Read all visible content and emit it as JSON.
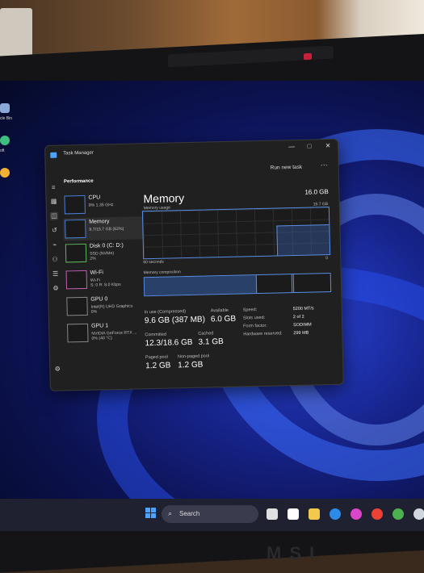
{
  "desktop": {
    "icons": [
      {
        "label": "cle Bin"
      },
      {
        "label": "oft"
      }
    ]
  },
  "task_manager": {
    "window_title": "Task Manager",
    "section_title": "Performance",
    "run_new_task": "Run new task",
    "more": "···",
    "window_buttons": {
      "minimize": "—",
      "maximize": "□",
      "close": "✕"
    },
    "sidebar": [
      {
        "name": "CPU",
        "sub": "9%  1.35 GHz",
        "sub2": ""
      },
      {
        "name": "Memory",
        "sub": "9.7/15.7 GB (62%)",
        "sub2": ""
      },
      {
        "name": "Disk 0 (C: D:)",
        "sub": "SSD (NVMe)",
        "sub2": "2%"
      },
      {
        "name": "Wi-Fi",
        "sub": "Wi-Fi",
        "sub2": "S: 0  R: 8.0 Kbps"
      },
      {
        "name": "GPU 0",
        "sub": "Intel(R) UHD Graphics",
        "sub2": "0%"
      },
      {
        "name": "GPU 1",
        "sub": "NVIDIA GeForce RTX ...",
        "sub2": "0% (40 °C)"
      }
    ],
    "memory": {
      "title": "Memory",
      "total": "16.0 GB",
      "usage_label": "Memory usage",
      "usage_max": "15.7 GB",
      "axis_left": "60 seconds",
      "axis_right": "0",
      "composition_label": "Memory composition",
      "in_use_label": "In use (Compressed)",
      "in_use_value": "9.6 GB (387 MB)",
      "available_label": "Available",
      "available_value": "6.0 GB",
      "committed_label": "Committed",
      "committed_value": "12.3/18.6 GB",
      "cached_label": "Cached",
      "cached_value": "3.1 GB",
      "paged_label": "Paged pool",
      "paged_value": "1.2 GB",
      "nonpaged_label": "Non-paged pool",
      "nonpaged_value": "1.2 GB",
      "details": [
        {
          "k": "Speed:",
          "v": "5200 MT/s"
        },
        {
          "k": "Slots used:",
          "v": "2 of 2"
        },
        {
          "k": "Form factor:",
          "v": "SODIMM"
        },
        {
          "k": "Hardware reserved:",
          "v": "299 MB"
        }
      ],
      "usage_fraction": 0.62
    }
  },
  "taskbar": {
    "search_placeholder": "Search",
    "icon_colors": [
      "#e0e0e0",
      "#ffffff",
      "#f2c94c",
      "#2b8be6",
      "#d946c9",
      "#ea4335",
      "#4caf50",
      "#cfd8dc"
    ]
  },
  "brand": "MSI"
}
